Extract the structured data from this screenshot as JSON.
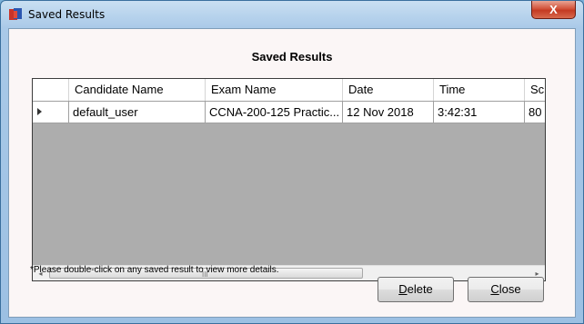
{
  "window": {
    "title": "Saved Results",
    "close_glyph": "X"
  },
  "dialog": {
    "heading": "Saved Results"
  },
  "grid": {
    "columns": [
      "Candidate Name",
      "Exam Name",
      "Date",
      "Time",
      "Sc"
    ],
    "rows": [
      {
        "candidate": "default_user",
        "exam": "CCNA-200-125 Practic...",
        "date": "12 Nov 2018",
        "time": "3:42:31",
        "score": "80"
      }
    ]
  },
  "scrollbar": {
    "left_arrow": "◂",
    "right_arrow": "▸",
    "grip": "III"
  },
  "note": "*Please double-click on any saved result to view  more details.",
  "buttons": {
    "delete": {
      "mnemonic": "D",
      "rest": "elete"
    },
    "close": {
      "mnemonic": "C",
      "rest": "lose"
    }
  }
}
